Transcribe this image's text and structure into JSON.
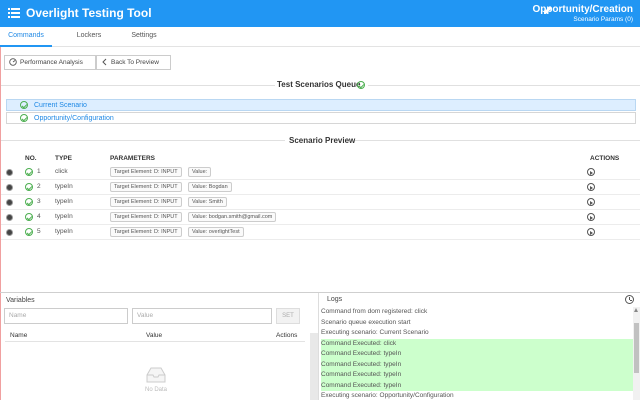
{
  "header": {
    "title": "Overlight Testing Tool",
    "record_title": "Opportunity/Creation",
    "record_subtitle": "Scenario Params (0)",
    "menu_icon": "menu-icon",
    "edit_icon": "edit-icon",
    "color": "#2196f3"
  },
  "tabs": [
    {
      "label": "Commands",
      "active": true
    },
    {
      "label": "Lockers",
      "active": false
    },
    {
      "label": "Settings",
      "active": false
    }
  ],
  "toolbar": {
    "performance_label": "Performance Analysis",
    "back_label": "Back To Preview"
  },
  "queue": {
    "title": "Test Scenarios Queue",
    "items": [
      {
        "label": "Current Scenario",
        "active": true
      },
      {
        "label": "Opportunity/Configuration",
        "active": false
      }
    ]
  },
  "preview": {
    "title": "Scenario Preview",
    "columns": {
      "no": "NO.",
      "type": "TYPE",
      "params": "PARAMETERS",
      "actions": "ACTIONS"
    },
    "rows": [
      {
        "no": "1",
        "type": "click",
        "target": "Target Element: D: INPUT",
        "value": "Value:"
      },
      {
        "no": "2",
        "type": "typeIn",
        "target": "Target Element: D: INPUT",
        "value": "Value: Bogdan"
      },
      {
        "no": "3",
        "type": "typeIn",
        "target": "Target Element: D: INPUT",
        "value": "Value: Smith"
      },
      {
        "no": "4",
        "type": "typeIn",
        "target": "Target Element: D: INPUT",
        "value": "Value: bodgan.smith@gmail.com"
      },
      {
        "no": "5",
        "type": "typeIn",
        "target": "Target Element: D: INPUT",
        "value": "Value: overlightTest"
      }
    ]
  },
  "variables": {
    "title": "Variables",
    "name_placeholder": "Name",
    "value_placeholder": "Value",
    "set_label": "SET",
    "columns": {
      "name": "Name",
      "value": "Value",
      "actions": "Actions"
    },
    "empty_text": "No Data"
  },
  "logs": {
    "title": "Logs",
    "lines": [
      {
        "text": "Command from dom registered: click",
        "ok": false
      },
      {
        "text": "Scenario queue execution start",
        "ok": false
      },
      {
        "text": "Executing scenario: Current Scenario",
        "ok": false
      },
      {
        "text": "Command Executed: click",
        "ok": true
      },
      {
        "text": "Command Executed: typeIn",
        "ok": true
      },
      {
        "text": "Command Executed: typeIn",
        "ok": true
      },
      {
        "text": "Command Executed: typeIn",
        "ok": true
      },
      {
        "text": "Command Executed: typeIn",
        "ok": true
      },
      {
        "text": "Executing scenario: Opportunity/Configuration",
        "ok": false
      }
    ]
  }
}
